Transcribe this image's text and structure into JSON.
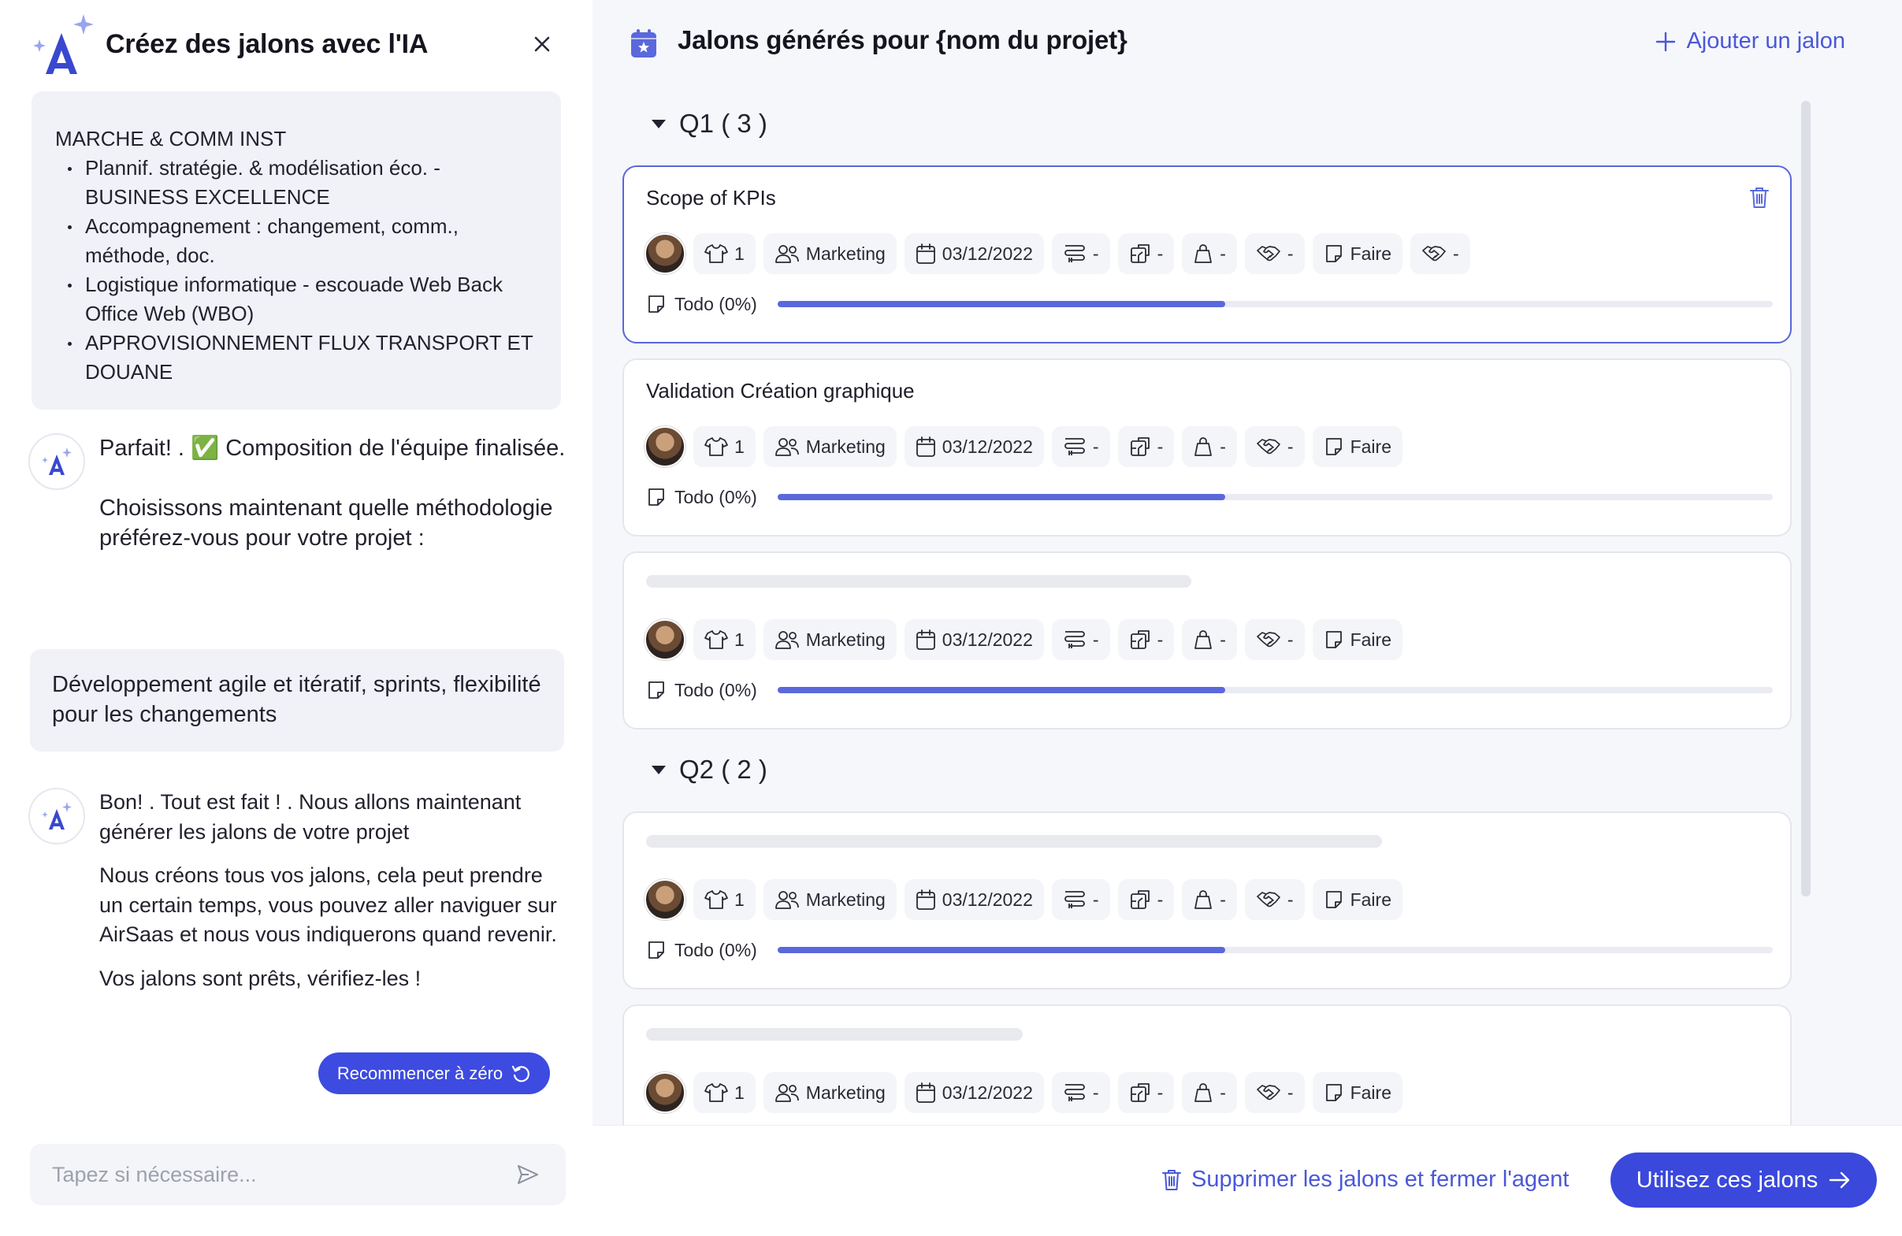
{
  "left": {
    "title": "Créez des jalons avec l'IA",
    "prompt": {
      "category": "MARCHE & COMM INST",
      "items": [
        "Plannif. stratégie. & modélisation éco. - BUSINESS EXCELLENCE",
        "Accompagnement : changement, comm., méthode, doc.",
        "Logistique informatique - escouade Web Back Office Web (WBO)",
        "APPROVISIONNEMENT FLUX TRANSPORT ET DOUANE"
      ]
    },
    "msg1": {
      "line1_prefix": "Parfait! . ",
      "check": "✅",
      "line1_suffix": " Composition de l'équipe finalisée.",
      "line2": "Choisissons maintenant quelle méthodologie préférez-vous pour votre projet :"
    },
    "user_reply": "Développement agile et itératif, sprints, flexibilité pour les changements",
    "msg2": {
      "p1": "Bon! . Tout est fait ! . Nous allons maintenant générer les jalons de votre projet",
      "p2": "Nous créons tous vos jalons, cela peut prendre un certain temps, vous pouvez aller naviguer sur AirSaas et nous vous indiquerons quand revenir.",
      "p3": "Vos jalons sont prêts, vérifiez-les !"
    },
    "reset_label": "Recommencer à zéro",
    "input_placeholder": "Tapez si nécessaire..."
  },
  "right": {
    "title": "Jalons générés pour {nom du projet}",
    "add_label": "Ajouter un jalon",
    "groups": [
      {
        "label": "Q1 ( 3 )"
      },
      {
        "label": "Q2 ( 2 )"
      }
    ],
    "cards": [
      {
        "title": "Scope of KPIs",
        "owner_count": "1",
        "team": "Marketing",
        "date": "03/12/2022",
        "dash": "-",
        "status": "Faire",
        "progress_label": "Todo (0%)",
        "progress": 0.45
      },
      {
        "title": "Validation Création graphique",
        "owner_count": "1",
        "team": "Marketing",
        "date": "03/12/2022",
        "dash": "-",
        "status": "Faire",
        "progress_label": "Todo (0%)",
        "progress": 0.45
      },
      {
        "title": "",
        "owner_count": "1",
        "team": "Marketing",
        "date": "03/12/2022",
        "dash": "-",
        "status": "Faire",
        "progress_label": "Todo (0%)",
        "progress": 0.45
      },
      {
        "title": "",
        "owner_count": "1",
        "team": "Marketing",
        "date": "03/12/2022",
        "dash": "-",
        "status": "Faire",
        "progress_label": "Todo (0%)",
        "progress": 0.45
      },
      {
        "title": "",
        "owner_count": "1",
        "team": "Marketing",
        "date": "03/12/2022",
        "dash": "-",
        "status": "Faire"
      }
    ]
  },
  "footer": {
    "delete_label": "Supprimer les jalons et fermer l'agent",
    "use_label": "Utilisez ces jalons"
  },
  "colors": {
    "accent": "#3d4be0",
    "accent_text": "#4a58d8",
    "progress": "#5a68dc",
    "panel_bg": "#f6f7fb"
  }
}
